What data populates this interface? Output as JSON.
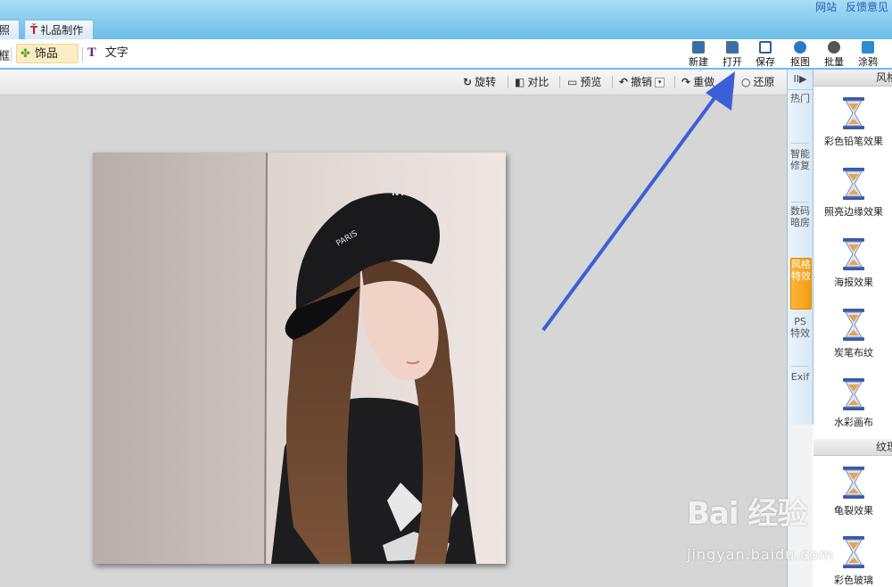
{
  "top": {
    "links": [
      "网站",
      "反馈意见"
    ],
    "tabs": [
      {
        "label": "照"
      },
      {
        "label": "礼品制作"
      }
    ]
  },
  "toolbar": {
    "left_cut": "框",
    "decorations": "饰品",
    "text": "文字",
    "buttons": [
      {
        "label": "新建"
      },
      {
        "label": "打开"
      },
      {
        "label": "保存"
      },
      {
        "label": "抠图"
      },
      {
        "label": "批量"
      },
      {
        "label": "涂鸦"
      }
    ]
  },
  "subbar": {
    "rotate": "旋转",
    "compare": "对比",
    "preview": "预览",
    "undo": "撤销",
    "redo": "重做",
    "restore": "还原"
  },
  "right_panel": {
    "collapse": "II▶",
    "tabs": [
      {
        "label": "热门"
      },
      {
        "label": "智能修复"
      },
      {
        "label": "数码暗房"
      },
      {
        "label": "风格特效"
      },
      {
        "label": "PS特效"
      },
      {
        "label": "Exif"
      }
    ],
    "active_tab": "风格特效",
    "section1": "风格",
    "effects": [
      "彩色铅笔效果",
      "照亮边缘效果",
      "海报效果",
      "炭笔布纹",
      "水彩画布"
    ],
    "section2": "纹理",
    "effects2": [
      "龟裂效果",
      "彩色玻璃"
    ]
  },
  "watermark": {
    "brand": "Bai 经验",
    "url": "jingyan.baidu.com"
  },
  "colors": {
    "accent_blue": "#6cbde9",
    "active_tab": "#f29b12",
    "arrow": "#3c5fd8"
  }
}
